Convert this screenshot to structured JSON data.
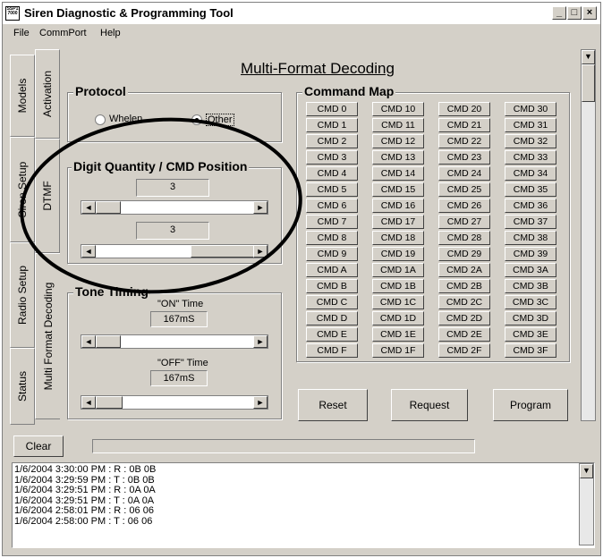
{
  "window": {
    "title": "Siren Diagnostic & Programming Tool",
    "icon_text": "SSP1 7000",
    "min": "_",
    "max": "□",
    "close": "×"
  },
  "menu": [
    "File",
    "CommPort",
    "Help"
  ],
  "tabs_outer": [
    "Models",
    "Siren Setup",
    "Radio Setup",
    "Status"
  ],
  "tabs_inner": [
    "Activation",
    "DTMF",
    "Multi Format Decoding"
  ],
  "page": {
    "title": "Multi-Format Decoding"
  },
  "protocol": {
    "label": "Protocol",
    "options": [
      "Whelen",
      "Other"
    ],
    "selected": "Other"
  },
  "digit": {
    "label": "Digit Quantity / CMD Position",
    "value1": "3",
    "value2": "3"
  },
  "tone": {
    "label": "Tone Timing",
    "on_label": "\"ON\" Time",
    "on_value": "167mS",
    "off_label": "\"OFF\" Time",
    "off_value": "167mS"
  },
  "command_map": {
    "label": "Command Map",
    "columns": [
      [
        "CMD 0",
        "CMD 1",
        "CMD 2",
        "CMD 3",
        "CMD 4",
        "CMD 5",
        "CMD 6",
        "CMD 7",
        "CMD 8",
        "CMD 9",
        "CMD A",
        "CMD B",
        "CMD C",
        "CMD D",
        "CMD E",
        "CMD F"
      ],
      [
        "CMD 10",
        "CMD 11",
        "CMD 12",
        "CMD 13",
        "CMD 14",
        "CMD 15",
        "CMD 16",
        "CMD 17",
        "CMD 18",
        "CMD 19",
        "CMD 1A",
        "CMD 1B",
        "CMD 1C",
        "CMD 1D",
        "CMD 1E",
        "CMD 1F"
      ],
      [
        "CMD 20",
        "CMD 21",
        "CMD 22",
        "CMD 23",
        "CMD 24",
        "CMD 25",
        "CMD 26",
        "CMD 27",
        "CMD 28",
        "CMD 29",
        "CMD 2A",
        "CMD 2B",
        "CMD 2C",
        "CMD 2D",
        "CMD 2E",
        "CMD 2F"
      ],
      [
        "CMD 30",
        "CMD 31",
        "CMD 32",
        "CMD 33",
        "CMD 34",
        "CMD 35",
        "CMD 36",
        "CMD 37",
        "CMD 38",
        "CMD 39",
        "CMD 3A",
        "CMD 3B",
        "CMD 3C",
        "CMD 3D",
        "CMD 3E",
        "CMD 3F"
      ]
    ]
  },
  "actions": {
    "reset": "Reset",
    "request": "Request",
    "program": "Program"
  },
  "bottom": {
    "clear": "Clear"
  },
  "log": [
    "1/6/2004 3:30:00 PM : R : 0B 0B",
    "1/6/2004 3:29:59 PM : T : 0B 0B",
    "1/6/2004 3:29:51 PM : R : 0A 0A",
    "1/6/2004 3:29:51 PM : T : 0A 0A",
    "1/6/2004 2:58:01 PM : R : 06 06",
    "1/6/2004 2:58:00 PM : T : 06 06"
  ],
  "scroll_arrows": {
    "up": "▲",
    "down": "▼",
    "left": "◄",
    "right": "►"
  }
}
